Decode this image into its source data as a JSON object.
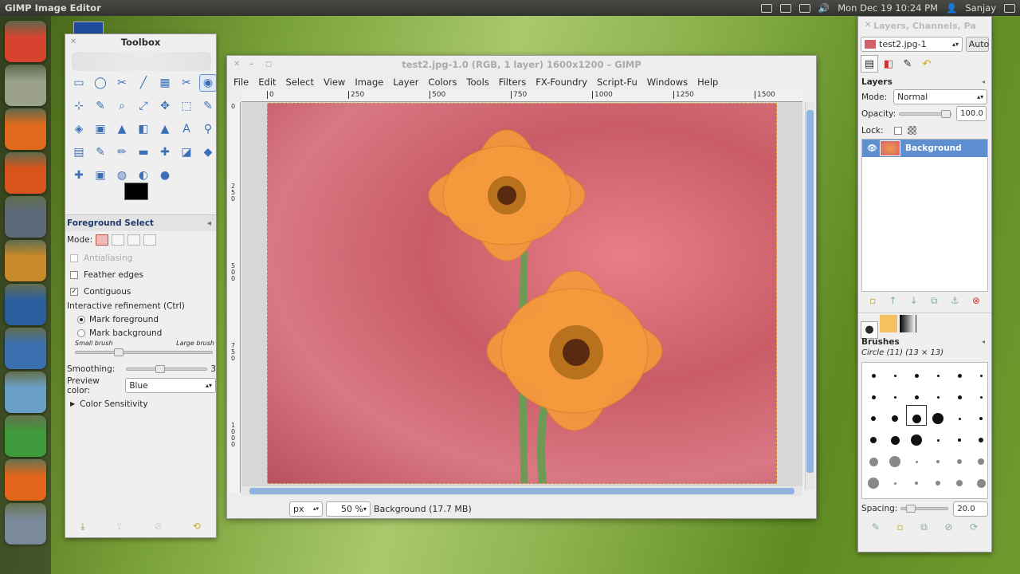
{
  "top_panel": {
    "app_title": "GIMP Image Editor",
    "datetime": "Mon Dec 19 10:24 PM",
    "user": "Sanjay"
  },
  "launcher": {
    "items": [
      {
        "name": "ubuntu-icon",
        "color": "#d6432e"
      },
      {
        "name": "home-folder-icon",
        "color": "#9aa08a"
      },
      {
        "name": "firefox-icon",
        "color": "#e06a1c"
      },
      {
        "name": "software-center-icon",
        "color": "#d9541c"
      },
      {
        "name": "synaptic-icon",
        "color": "#5d6a7a"
      },
      {
        "name": "archive-icon",
        "color": "#c88a2a"
      },
      {
        "name": "system-monitor-icon",
        "color": "#2a5e9e"
      },
      {
        "name": "glass-icon",
        "color": "#3a6fb0"
      },
      {
        "name": "bowl-icon",
        "color": "#6aa0c8"
      },
      {
        "name": "green-g-icon",
        "color": "#3e9a3a"
      },
      {
        "name": "orange-u-icon",
        "color": "#e2661c"
      },
      {
        "name": "files-icon",
        "color": "#7a8a9a"
      }
    ]
  },
  "toolbox": {
    "title": "Toolbox",
    "tools": [
      "▭",
      "◯",
      "✂",
      "╱",
      "▦",
      "✂",
      "◉",
      "⊹",
      "✎",
      "⌕",
      "⤢",
      "✥",
      "⬚",
      "✎",
      "◈",
      "▣",
      "▲",
      "◧",
      "▲",
      "A",
      "⚲",
      "▤",
      "✎",
      "✏",
      "▬",
      "✚",
      "◪",
      "◆",
      "✚",
      "▣",
      "◍",
      "◐",
      "●"
    ],
    "selected_tool_index": 6
  },
  "fg_select": {
    "title": "Foreground Select",
    "mode_label": "Mode:",
    "antialiasing": "Antialiasing",
    "feather": "Feather edges",
    "contiguous": "Contiguous",
    "refinement": "Interactive refinement  (Ctrl)",
    "mark_fg": "Mark foreground",
    "mark_bg": "Mark background",
    "small_brush": "Small brush",
    "large_brush": "Large brush",
    "brush_level": 0.3,
    "smoothing_label": "Smoothing:",
    "smoothing_value": "3",
    "preview_label": "Preview color:",
    "preview_value": "Blue",
    "color_sensitivity": "Color Sensitivity"
  },
  "image_window": {
    "title": "test2.jpg-1.0 (RGB, 1 layer) 1600x1200 – GIMP",
    "menus": [
      "File",
      "Edit",
      "Select",
      "View",
      "Image",
      "Layer",
      "Colors",
      "Tools",
      "Filters",
      "FX-Foundry",
      "Script-Fu",
      "Windows",
      "Help"
    ],
    "ruler_h": [
      "0",
      "250",
      "500",
      "750",
      "1000",
      "1250",
      "1500"
    ],
    "ruler_v": [
      "0",
      "250",
      "500",
      "750",
      "1000"
    ],
    "unit": "px",
    "zoom": "50 %",
    "status": "Background (17.7 MB)"
  },
  "dock": {
    "title": "Layers, Channels, Pa",
    "image_select": "test2.jpg-1",
    "auto_label": "Auto",
    "layers_title": "Layers",
    "mode_label": "Mode:",
    "mode_value": "Normal",
    "opacity_label": "Opacity:",
    "opacity_value": "100.0",
    "lock_label": "Lock:",
    "layer_name": "Background",
    "brushes_title": "Brushes",
    "brush_name": "Circle (11) (13 × 13)",
    "spacing_label": "Spacing:",
    "spacing_value": "20.0"
  }
}
